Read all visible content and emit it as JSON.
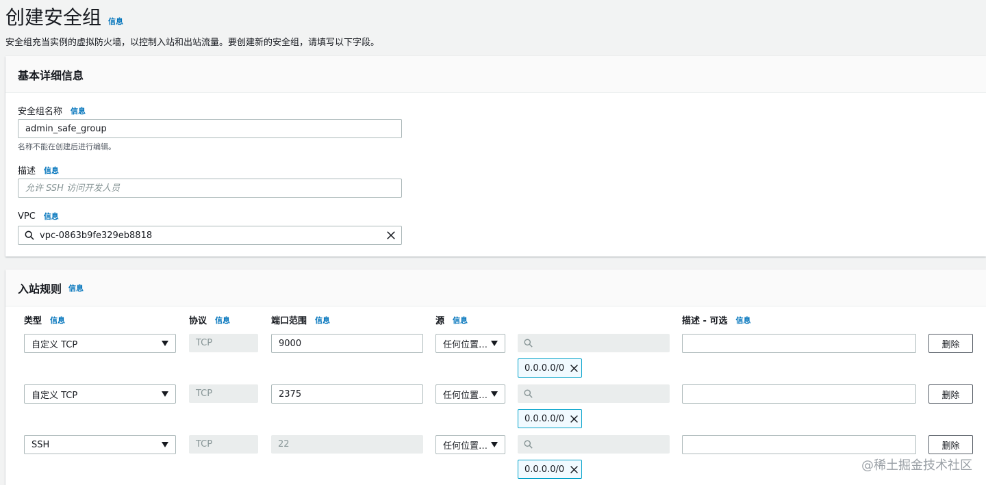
{
  "header": {
    "title": "创建安全组",
    "info": "信息",
    "description": "安全组充当实例的虚拟防火墙，以控制入站和出站流量。要创建新的安全组，请填写以下字段。"
  },
  "basic": {
    "title": "基本详细信息",
    "name_label": "安全组名称",
    "name_info": "信息",
    "name_value": "admin_safe_group",
    "name_hint": "名称不能在创建后进行编辑。",
    "desc_label": "描述",
    "desc_info": "信息",
    "desc_placeholder": "允许 SSH 访问开发人员",
    "vpc_label": "VPC",
    "vpc_info": "信息",
    "vpc_value": "vpc-0863b9fe329eb8818"
  },
  "inbound": {
    "title": "入站规则",
    "info": "信息",
    "columns": {
      "type": "类型",
      "protocol": "协议",
      "port": "端口范围",
      "source": "源",
      "desc": "描述 - 可选",
      "info": "信息"
    },
    "rows": [
      {
        "type": "自定义 TCP",
        "protocol": "TCP",
        "port": "9000",
        "source": "任何位置…",
        "cidr": "0.0.0.0/0",
        "delete": "删除"
      },
      {
        "type": "自定义 TCP",
        "protocol": "TCP",
        "port": "2375",
        "source": "任何位置…",
        "cidr": "0.0.0.0/0",
        "delete": "删除"
      },
      {
        "type": "SSH",
        "protocol": "TCP",
        "port": "22",
        "source": "任何位置…",
        "cidr": "0.0.0.0/0",
        "delete": "删除"
      }
    ]
  },
  "watermark": "@稀土掘金技术社区",
  "icons": {
    "search": "search-icon",
    "close": "close-icon",
    "caret": "caret-down-icon"
  },
  "colors": {
    "link": "#0073bb",
    "token_border": "#00a1c9",
    "token_bg": "#f1faff"
  }
}
